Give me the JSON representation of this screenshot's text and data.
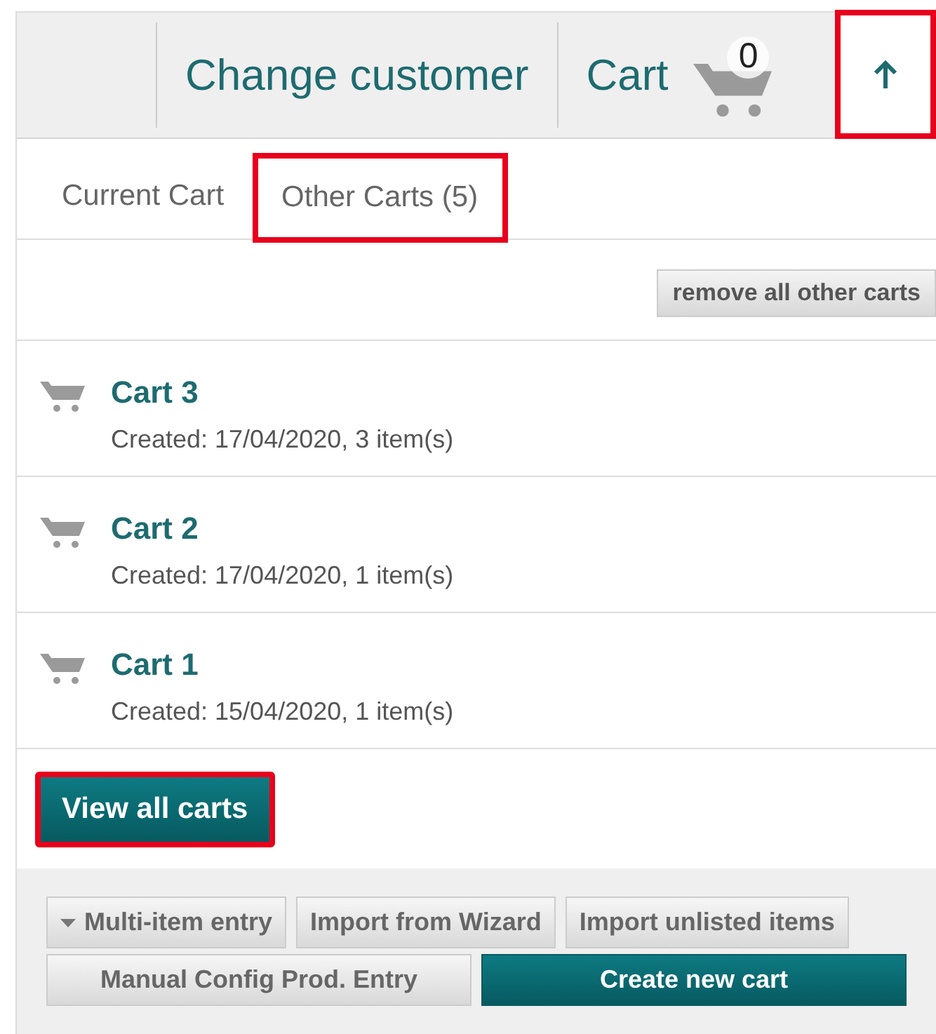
{
  "header": {
    "links": [
      {
        "label": "Change customer"
      },
      {
        "label": "Cart"
      }
    ],
    "cart_count": "0",
    "up_button": {
      "highlighted": true
    }
  },
  "tabs": [
    {
      "label": "Current Cart",
      "selected": false,
      "highlighted": false
    },
    {
      "label": "Other Carts (5)",
      "selected": true,
      "highlighted": true
    }
  ],
  "remove_button": "remove all other carts",
  "carts": [
    {
      "name": "Cart 3",
      "details": "Created: 17/04/2020, 3 item(s)"
    },
    {
      "name": "Cart 2",
      "details": "Created: 17/04/2020, 1 item(s)"
    },
    {
      "name": "Cart 1",
      "details": "Created: 15/04/2020, 1 item(s)"
    }
  ],
  "view_all_button": {
    "label": "View all carts",
    "highlighted": true
  },
  "footer_buttons": [
    {
      "label": "Multi-item entry",
      "kind": "dropdown"
    },
    {
      "label": "Import from Wizard",
      "kind": "plain"
    },
    {
      "label": "Import unlisted items",
      "kind": "plain"
    },
    {
      "label": "Manual Config Prod. Entry",
      "kind": "plain"
    },
    {
      "label": "Create new cart",
      "kind": "primary"
    }
  ]
}
